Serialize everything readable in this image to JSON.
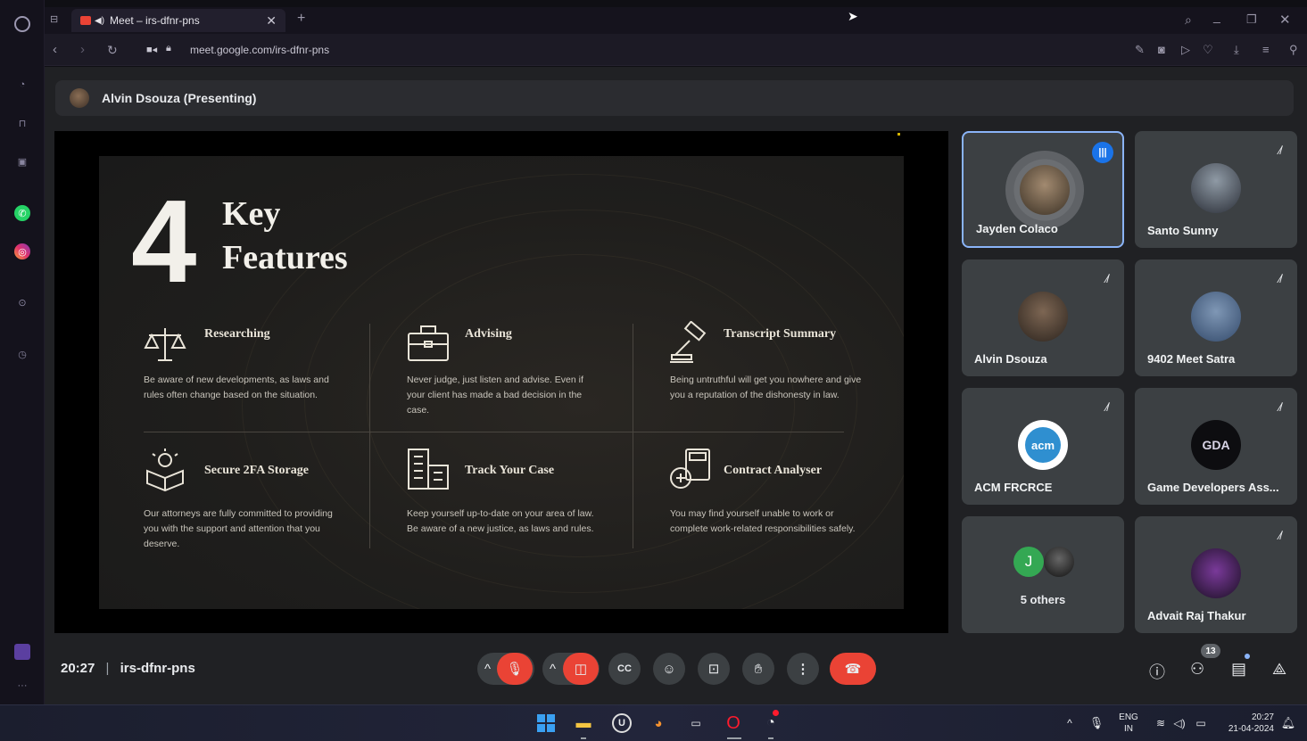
{
  "browser": {
    "tab_title": "Meet – irs-dfnr-pns",
    "url": "meet.google.com/irs-dfnr-pns"
  },
  "meet": {
    "presenter_label": "Alvin Dsouza (Presenting)",
    "time": "20:27",
    "meeting_code": "irs-dfnr-pns",
    "participants_badge": "13"
  },
  "slide": {
    "number": "4",
    "title_line1": "Key",
    "title_line2": "Features",
    "features": [
      {
        "title": "Researching",
        "desc": "Be aware of new developments, as laws and rules often change based on the situation.",
        "icon": "scales-icon"
      },
      {
        "title": "Advising",
        "desc": "Never judge, just listen and advise. Even if your client has made a bad decision in the case.",
        "icon": "briefcase-icon"
      },
      {
        "title": "Transcript Summary",
        "desc": "Being untruthful will get you nowhere and give you a reputation of the dishonesty in law.",
        "icon": "gavel-icon"
      },
      {
        "title": "Secure 2FA Storage",
        "desc": "Our attorneys are fully committed to providing you with the support and attention that you deserve.",
        "icon": "secure-box-icon"
      },
      {
        "title": "Track Your Case",
        "desc": "Keep yourself up-to-date on your area of law. Be aware of a new justice, as laws and rules.",
        "icon": "building-icon"
      },
      {
        "title": "Contract Analyser",
        "desc": "You may find yourself unable to work or complete work-related responsibilities safely.",
        "icon": "calculator-icon"
      }
    ]
  },
  "participants": [
    {
      "name": "Jayden Colaco",
      "speaking": true
    },
    {
      "name": "Santo Sunny",
      "muted": true
    },
    {
      "name": "Alvin Dsouza",
      "muted": true
    },
    {
      "name": "9402 Meet Satra",
      "muted": true
    },
    {
      "name": "ACM FRCRCE",
      "muted": true,
      "logo_text": "acm"
    },
    {
      "name": "Game Developers Ass...",
      "muted": true,
      "logo_text": "GDA"
    },
    {
      "name": "5 others",
      "initial": "J"
    },
    {
      "name": "Advait Raj Thakur",
      "muted": true
    }
  ],
  "taskbar": {
    "lang_line1": "ENG",
    "lang_line2": "IN",
    "clock_time": "20:27",
    "clock_date": "21-04-2024"
  },
  "colors": {
    "accent_red": "#ea4335",
    "active_border": "#8ab4f8",
    "tile_bg": "#3c4043"
  }
}
